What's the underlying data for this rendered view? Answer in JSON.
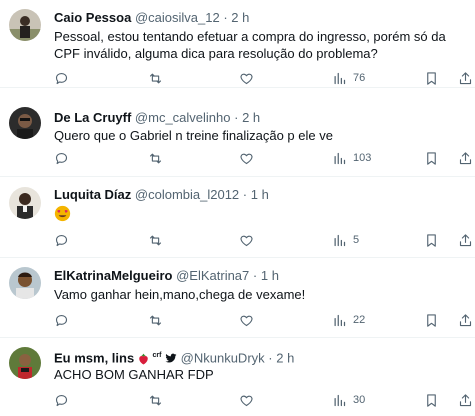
{
  "tweets": [
    {
      "display_name": "Caio Pessoa",
      "handle": "@caiosilva_12",
      "time": "2 h",
      "text": "Pessoal, estou tentando efetuar a compra do ingresso, porém só da CPF inválido, alguma dica para resolução do problema?",
      "views": "76"
    },
    {
      "display_name": "De La Cruyff",
      "handle": "@mc_calvelinho",
      "time": "2 h",
      "text": "Quero que o Gabriel n treine finalização p ele ve",
      "views": "103"
    },
    {
      "display_name": "Luquita Díaz",
      "handle": "@colombia_l2012",
      "time": "1 h",
      "text": "",
      "emoji": "heart-eyes",
      "views": "5"
    },
    {
      "display_name": "ElKatrinaMelgueiro",
      "handle": "@ElKatrina7",
      "time": "1 h",
      "text": "Vamo ganhar hein,mano,chega de vexame!",
      "views": "22"
    },
    {
      "display_name": "Eu msm, lins",
      "name_badges": [
        "strawberry-icon",
        "crf-text-icon",
        "bird-icon"
      ],
      "badge_text": "crf",
      "handle": "@NkunkuDryk",
      "time": "2 h",
      "text": "ACHO BOM GANHAR FDP",
      "views": "30"
    }
  ],
  "separator": "·",
  "colors": {
    "text": "#0f1419",
    "muted": "#536471",
    "divider": "#eff3f4",
    "heart_eyes_face": "#f4b400",
    "heart_eyes_heart": "#e0245e"
  }
}
